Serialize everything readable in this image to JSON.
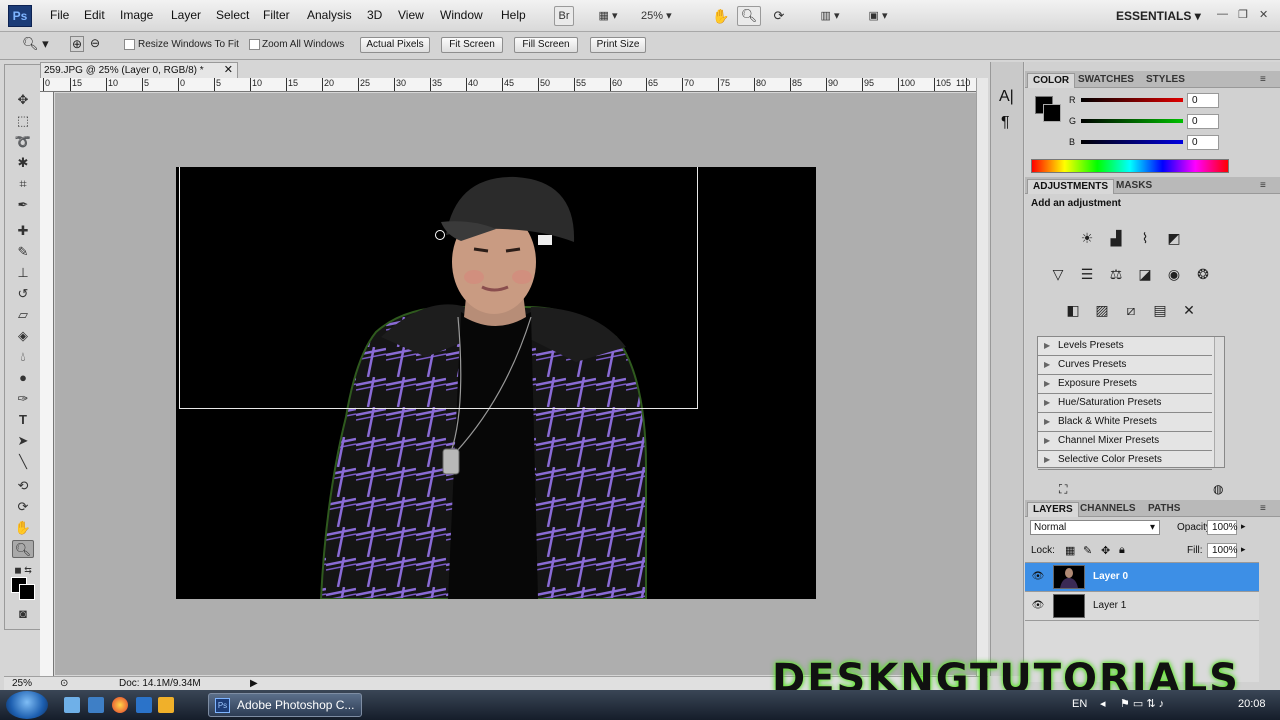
{
  "app": {
    "logo": "Ps",
    "menu": [
      "File",
      "Edit",
      "Image",
      "Layer",
      "Select",
      "Filter",
      "Analysis",
      "3D",
      "View",
      "Window",
      "Help"
    ],
    "bridge_label": "Br",
    "zoom_dropdown": "25%",
    "workspace": "ESSENTIALS",
    "window_controls": {
      "minimize": "—",
      "restore": "❐",
      "close": "✕"
    }
  },
  "options_bar": {
    "resize_windows_label": "Resize Windows To Fit",
    "zoom_all_label": "Zoom All Windows",
    "actual_pixels": "Actual Pixels",
    "fit_screen": "Fit Screen",
    "fill_screen": "Fill Screen",
    "print_size": "Print Size"
  },
  "document": {
    "tab_title": "259.JPG @ 25% (Layer 0, RGB/8) *",
    "close_glyph": "✕",
    "ruler_labels": [
      "0",
      "15",
      "10",
      "5",
      "0",
      "5",
      "10",
      "15",
      "20",
      "25",
      "30",
      "35",
      "40",
      "45",
      "50",
      "55",
      "60",
      "65",
      "70",
      "75",
      "80",
      "85",
      "90",
      "95",
      "100",
      "105",
      "110"
    ],
    "zoom_status": "25%",
    "doc_info": "Doc: 14.1M/9.34M"
  },
  "color_panel": {
    "tabs": [
      "COLOR",
      "SWATCHES",
      "STYLES"
    ],
    "channels": [
      {
        "label": "R",
        "value": "0",
        "color": "#cc0000"
      },
      {
        "label": "G",
        "value": "0",
        "color": "#00aa00"
      },
      {
        "label": "B",
        "value": "0",
        "color": "#0000cc"
      }
    ]
  },
  "adjustments_panel": {
    "tabs": [
      "ADJUSTMENTS",
      "MASKS"
    ],
    "heading": "Add an adjustment",
    "presets": [
      "Levels Presets",
      "Curves Presets",
      "Exposure Presets",
      "Hue/Saturation Presets",
      "Black & White Presets",
      "Channel Mixer Presets",
      "Selective Color Presets"
    ]
  },
  "layers_panel": {
    "tabs": [
      "LAYERS",
      "CHANNELS",
      "PATHS"
    ],
    "blend_mode": "Normal",
    "opacity_label": "Opacity:",
    "opacity_value": "100%",
    "lock_label": "Lock:",
    "fill_label": "Fill:",
    "fill_value": "100%",
    "layers": [
      {
        "name": "Layer 0",
        "selected": true
      },
      {
        "name": "Layer 1",
        "selected": false
      }
    ]
  },
  "taskbar": {
    "active_task": "Adobe Photoshop C...",
    "language": "EN",
    "clock": "20:08"
  },
  "watermark": "DESKNGTUTORIALS",
  "colors": {
    "selection_blue": "#3d8fe6",
    "canvas_gray": "#aeaeae",
    "watermark_glow": "#7dff3a"
  }
}
